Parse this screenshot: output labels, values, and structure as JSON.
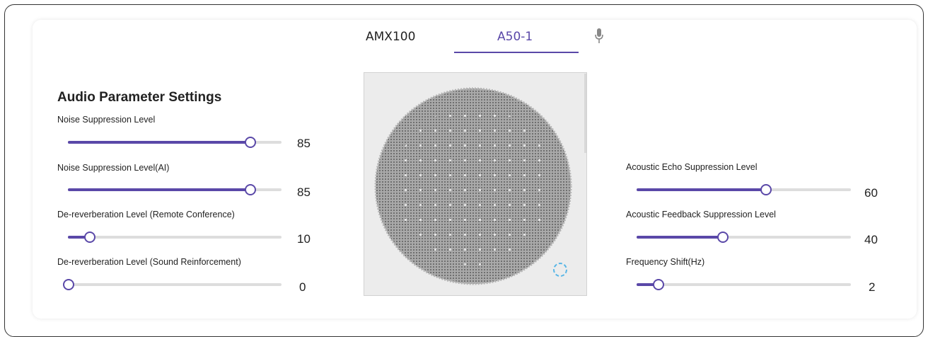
{
  "tabs": [
    {
      "label": "AMX100",
      "active": false
    },
    {
      "label": "A50-1",
      "active": true
    }
  ],
  "icons": {
    "mic": "microphone-icon",
    "loading": "loading-spinner-icon"
  },
  "colors": {
    "accent": "#5a48a8",
    "track": "#dddddd",
    "spinner": "#59b6e6",
    "grille": "#8c8c8c"
  },
  "section_title": "Audio Parameter Settings",
  "left_params": [
    {
      "label": "Noise Suppression Level",
      "value": "85",
      "percent": 85
    },
    {
      "label": "Noise Suppression Level(AI)",
      "value": "85",
      "percent": 85
    },
    {
      "label": "De-reverberation Level (Remote Conference)",
      "value": "10",
      "percent": 10
    },
    {
      "label": "De-reverberation Level (Sound Reinforcement)",
      "value": "0",
      "percent": 0
    }
  ],
  "right_params": [
    {
      "label": "Acoustic Echo Suppression Level",
      "value": "60",
      "percent": 60
    },
    {
      "label": "Acoustic Feedback Suppression Level",
      "value": "40",
      "percent": 40
    },
    {
      "label": "Frequency Shift(Hz)",
      "value": "2",
      "percent": 10
    }
  ]
}
